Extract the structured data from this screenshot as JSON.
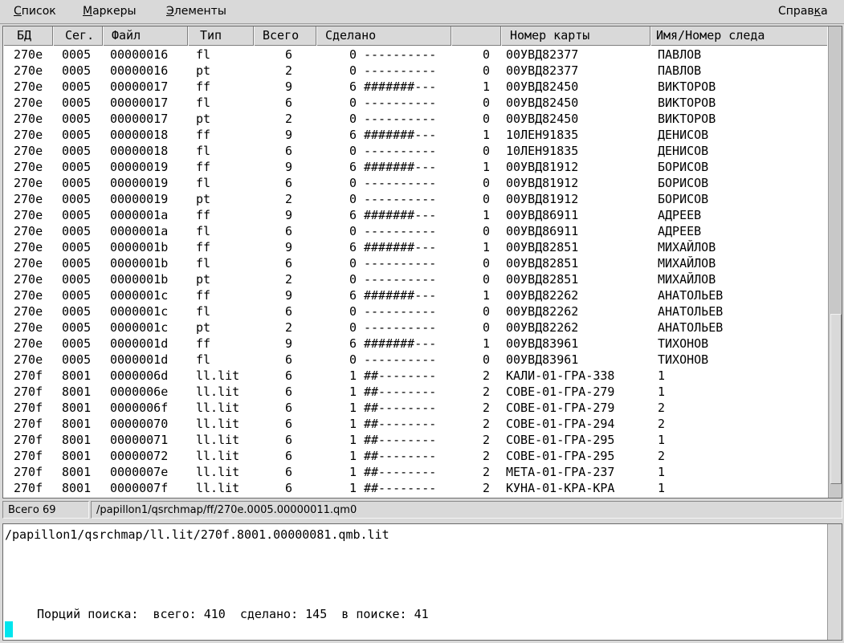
{
  "menu": {
    "list": {
      "first": "С",
      "rest": "писок"
    },
    "markers": {
      "first": "М",
      "rest": "аркеры"
    },
    "elements": {
      "first": "Э",
      "rest": "лементы"
    },
    "help": {
      "before": "Справ",
      "underlined": "к",
      "after": "а"
    }
  },
  "columns": [
    "БД",
    "Сег.",
    "Файл",
    "Тип",
    "Всего",
    "Сделано",
    "",
    "Номер карты",
    "Имя/Номер следа"
  ],
  "rows": [
    {
      "db": "270e",
      "seg": "0005",
      "file": "00000016",
      "type": "fl",
      "total": "6",
      "done": "0",
      "progress": "----------",
      "x": "0",
      "card": "00УВД82377",
      "name": "ПАВЛОВ"
    },
    {
      "db": "270e",
      "seg": "0005",
      "file": "00000016",
      "type": "pt",
      "total": "2",
      "done": "0",
      "progress": "----------",
      "x": "0",
      "card": "00УВД82377",
      "name": "ПАВЛОВ"
    },
    {
      "db": "270e",
      "seg": "0005",
      "file": "00000017",
      "type": "ff",
      "total": "9",
      "done": "6",
      "progress": "#######---",
      "x": "1",
      "card": "00УВД82450",
      "name": "ВИКТОРОВ"
    },
    {
      "db": "270e",
      "seg": "0005",
      "file": "00000017",
      "type": "fl",
      "total": "6",
      "done": "0",
      "progress": "----------",
      "x": "0",
      "card": "00УВД82450",
      "name": "ВИКТОРОВ"
    },
    {
      "db": "270e",
      "seg": "0005",
      "file": "00000017",
      "type": "pt",
      "total": "2",
      "done": "0",
      "progress": "----------",
      "x": "0",
      "card": "00УВД82450",
      "name": "ВИКТОРОВ"
    },
    {
      "db": "270e",
      "seg": "0005",
      "file": "00000018",
      "type": "ff",
      "total": "9",
      "done": "6",
      "progress": "#######---",
      "x": "1",
      "card": "10ЛЕН91835",
      "name": "ДЕНИСОВ"
    },
    {
      "db": "270e",
      "seg": "0005",
      "file": "00000018",
      "type": "fl",
      "total": "6",
      "done": "0",
      "progress": "----------",
      "x": "0",
      "card": "10ЛЕН91835",
      "name": "ДЕНИСОВ"
    },
    {
      "db": "270e",
      "seg": "0005",
      "file": "00000019",
      "type": "ff",
      "total": "9",
      "done": "6",
      "progress": "#######---",
      "x": "1",
      "card": "00УВД81912",
      "name": "БОРИСОВ"
    },
    {
      "db": "270e",
      "seg": "0005",
      "file": "00000019",
      "type": "fl",
      "total": "6",
      "done": "0",
      "progress": "----------",
      "x": "0",
      "card": "00УВД81912",
      "name": "БОРИСОВ"
    },
    {
      "db": "270e",
      "seg": "0005",
      "file": "00000019",
      "type": "pt",
      "total": "2",
      "done": "0",
      "progress": "----------",
      "x": "0",
      "card": "00УВД81912",
      "name": "БОРИСОВ"
    },
    {
      "db": "270e",
      "seg": "0005",
      "file": "0000001a",
      "type": "ff",
      "total": "9",
      "done": "6",
      "progress": "#######---",
      "x": "1",
      "card": "00УВД86911",
      "name": "АДРЕЕВ"
    },
    {
      "db": "270e",
      "seg": "0005",
      "file": "0000001a",
      "type": "fl",
      "total": "6",
      "done": "0",
      "progress": "----------",
      "x": "0",
      "card": "00УВД86911",
      "name": "АДРЕЕВ"
    },
    {
      "db": "270e",
      "seg": "0005",
      "file": "0000001b",
      "type": "ff",
      "total": "9",
      "done": "6",
      "progress": "#######---",
      "x": "1",
      "card": "00УВД82851",
      "name": "МИХАЙЛОВ"
    },
    {
      "db": "270e",
      "seg": "0005",
      "file": "0000001b",
      "type": "fl",
      "total": "6",
      "done": "0",
      "progress": "----------",
      "x": "0",
      "card": "00УВД82851",
      "name": "МИХАЙЛОВ"
    },
    {
      "db": "270e",
      "seg": "0005",
      "file": "0000001b",
      "type": "pt",
      "total": "2",
      "done": "0",
      "progress": "----------",
      "x": "0",
      "card": "00УВД82851",
      "name": "МИХАЙЛОВ"
    },
    {
      "db": "270e",
      "seg": "0005",
      "file": "0000001c",
      "type": "ff",
      "total": "9",
      "done": "6",
      "progress": "#######---",
      "x": "1",
      "card": "00УВД82262",
      "name": "АНАТОЛЬЕВ"
    },
    {
      "db": "270e",
      "seg": "0005",
      "file": "0000001c",
      "type": "fl",
      "total": "6",
      "done": "0",
      "progress": "----------",
      "x": "0",
      "card": "00УВД82262",
      "name": "АНАТОЛЬЕВ"
    },
    {
      "db": "270e",
      "seg": "0005",
      "file": "0000001c",
      "type": "pt",
      "total": "2",
      "done": "0",
      "progress": "----------",
      "x": "0",
      "card": "00УВД82262",
      "name": "АНАТОЛЬЕВ"
    },
    {
      "db": "270e",
      "seg": "0005",
      "file": "0000001d",
      "type": "ff",
      "total": "9",
      "done": "6",
      "progress": "#######---",
      "x": "1",
      "card": "00УВД83961",
      "name": "ТИХОНОВ"
    },
    {
      "db": "270e",
      "seg": "0005",
      "file": "0000001d",
      "type": "fl",
      "total": "6",
      "done": "0",
      "progress": "----------",
      "x": "0",
      "card": "00УВД83961",
      "name": "ТИХОНОВ"
    },
    {
      "db": "270f",
      "seg": "8001",
      "file": "0000006d",
      "type": "ll.lit",
      "total": "6",
      "done": "1",
      "progress": "##--------",
      "x": "2",
      "card": "КАЛИ-01-ГРА-338",
      "name": "1"
    },
    {
      "db": "270f",
      "seg": "8001",
      "file": "0000006e",
      "type": "ll.lit",
      "total": "6",
      "done": "1",
      "progress": "##--------",
      "x": "2",
      "card": "СОВЕ-01-ГРА-279",
      "name": "1"
    },
    {
      "db": "270f",
      "seg": "8001",
      "file": "0000006f",
      "type": "ll.lit",
      "total": "6",
      "done": "1",
      "progress": "##--------",
      "x": "2",
      "card": "СОВЕ-01-ГРА-279",
      "name": "2"
    },
    {
      "db": "270f",
      "seg": "8001",
      "file": "00000070",
      "type": "ll.lit",
      "total": "6",
      "done": "1",
      "progress": "##--------",
      "x": "2",
      "card": "СОВЕ-01-ГРА-294",
      "name": "2"
    },
    {
      "db": "270f",
      "seg": "8001",
      "file": "00000071",
      "type": "ll.lit",
      "total": "6",
      "done": "1",
      "progress": "##--------",
      "x": "2",
      "card": "СОВЕ-01-ГРА-295",
      "name": "1"
    },
    {
      "db": "270f",
      "seg": "8001",
      "file": "00000072",
      "type": "ll.lit",
      "total": "6",
      "done": "1",
      "progress": "##--------",
      "x": "2",
      "card": "СОВЕ-01-ГРА-295",
      "name": "2"
    },
    {
      "db": "270f",
      "seg": "8001",
      "file": "0000007e",
      "type": "ll.lit",
      "total": "6",
      "done": "1",
      "progress": "##--------",
      "x": "2",
      "card": "МЕТА-01-ГРА-237",
      "name": "1"
    },
    {
      "db": "270f",
      "seg": "8001",
      "file": "0000007f",
      "type": "ll.lit",
      "total": "6",
      "done": "1",
      "progress": "##--------",
      "x": "2",
      "card": "КУНА-01-КРА-КРА",
      "name": "1"
    }
  ],
  "status": {
    "total": "Всего 69",
    "path": "/papillon1/qsrchmap/ff/270e.0005.00000011.qm0"
  },
  "console": {
    "path_line": "/papillon1/qsrchmap/ll.lit/270f.8001.00000081.qmb.lit",
    "summary_line": "Порций поиска:  всего: 410  сделано: 145  в поиске: 41"
  }
}
